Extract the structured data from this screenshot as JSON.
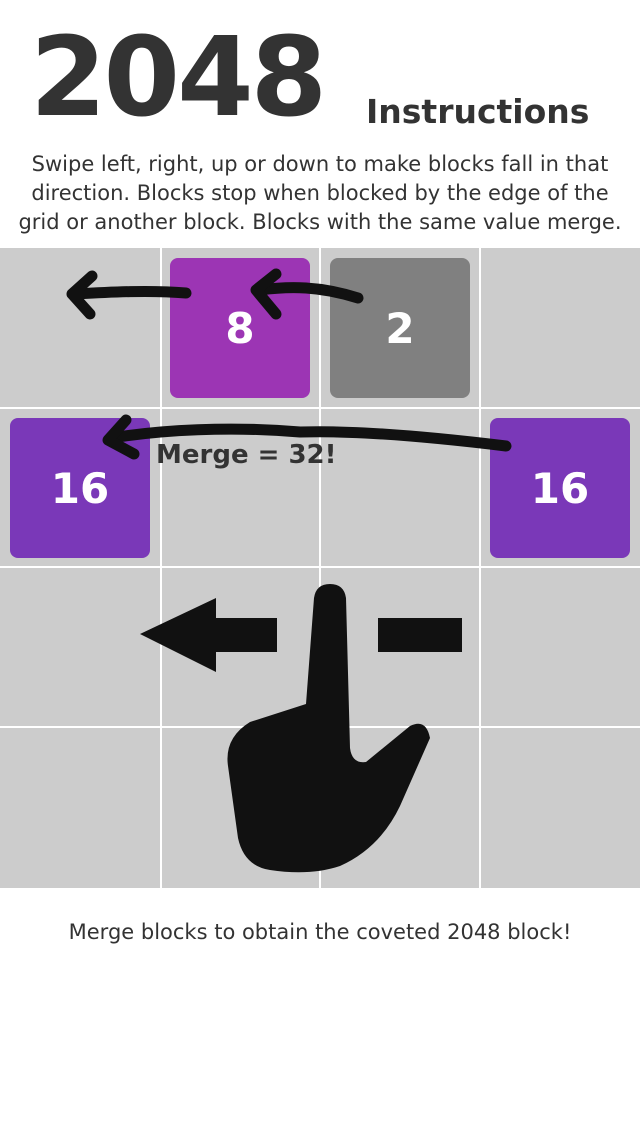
{
  "header": {
    "logo": "2048",
    "heading": "Instructions"
  },
  "instructions": "Swipe left, right, up or down to make blocks fall in that direction. Blocks stop when blocked by the edge of the grid or another block. Blocks with the same value merge.",
  "board": {
    "tiles": [
      {
        "value": "8",
        "row": 0,
        "col": 1,
        "color": "#9c35b4"
      },
      {
        "value": "2",
        "row": 0,
        "col": 2,
        "color": "#808080"
      },
      {
        "value": "16",
        "row": 1,
        "col": 0,
        "color": "#7a38b8"
      },
      {
        "value": "16",
        "row": 1,
        "col": 3,
        "color": "#7a38b8"
      }
    ],
    "merge_label": "Merge = 32!",
    "icons": [
      "arrow-left-icon",
      "swipe-hand-icon"
    ]
  },
  "footer": "Merge blocks to obtain the coveted 2048 block!",
  "colors": {
    "board_bg": "#cccccc",
    "text": "#333333",
    "ink": "#111111"
  }
}
